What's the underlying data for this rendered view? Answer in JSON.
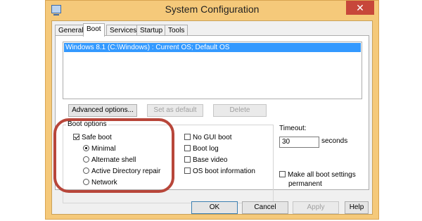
{
  "window": {
    "title": "System Configuration",
    "close_glyph": "✕"
  },
  "tabs": [
    {
      "label": "General",
      "active": false
    },
    {
      "label": "Boot",
      "active": true
    },
    {
      "label": "Services",
      "active": false
    },
    {
      "label": "Startup",
      "active": false
    },
    {
      "label": "Tools",
      "active": false
    }
  ],
  "os_list": {
    "items": [
      "Windows 8.1 (C:\\Windows) : Current OS; Default OS"
    ],
    "selected_index": 0
  },
  "buttons": {
    "advanced": "Advanced options...",
    "set_default": "Set as default",
    "delete": "Delete",
    "ok": "OK",
    "cancel": "Cancel",
    "apply": "Apply",
    "help": "Help"
  },
  "boot_options": {
    "title": "Boot options",
    "safe_boot": {
      "label": "Safe boot",
      "checked": true
    },
    "safe_modes": [
      {
        "label": "Minimal",
        "checked": true
      },
      {
        "label": "Alternate shell",
        "checked": false
      },
      {
        "label": "Active Directory repair",
        "checked": false
      },
      {
        "label": "Network",
        "checked": false
      }
    ],
    "flags": [
      {
        "label": "No GUI boot",
        "checked": false
      },
      {
        "label": "Boot log",
        "checked": false
      },
      {
        "label": "Base video",
        "checked": false
      },
      {
        "label": "OS boot information",
        "checked": false
      }
    ]
  },
  "timeout": {
    "label": "Timeout:",
    "value": "30",
    "unit": "seconds"
  },
  "make_permanent": {
    "label_line1": "Make all boot settings",
    "label_line2": "permanent",
    "checked": false
  },
  "colors": {
    "highlight_ring": "#b8463a",
    "selection": "#3399ff",
    "frame": "#f5c97a"
  },
  "icons": {
    "app": "system-config-icon"
  }
}
